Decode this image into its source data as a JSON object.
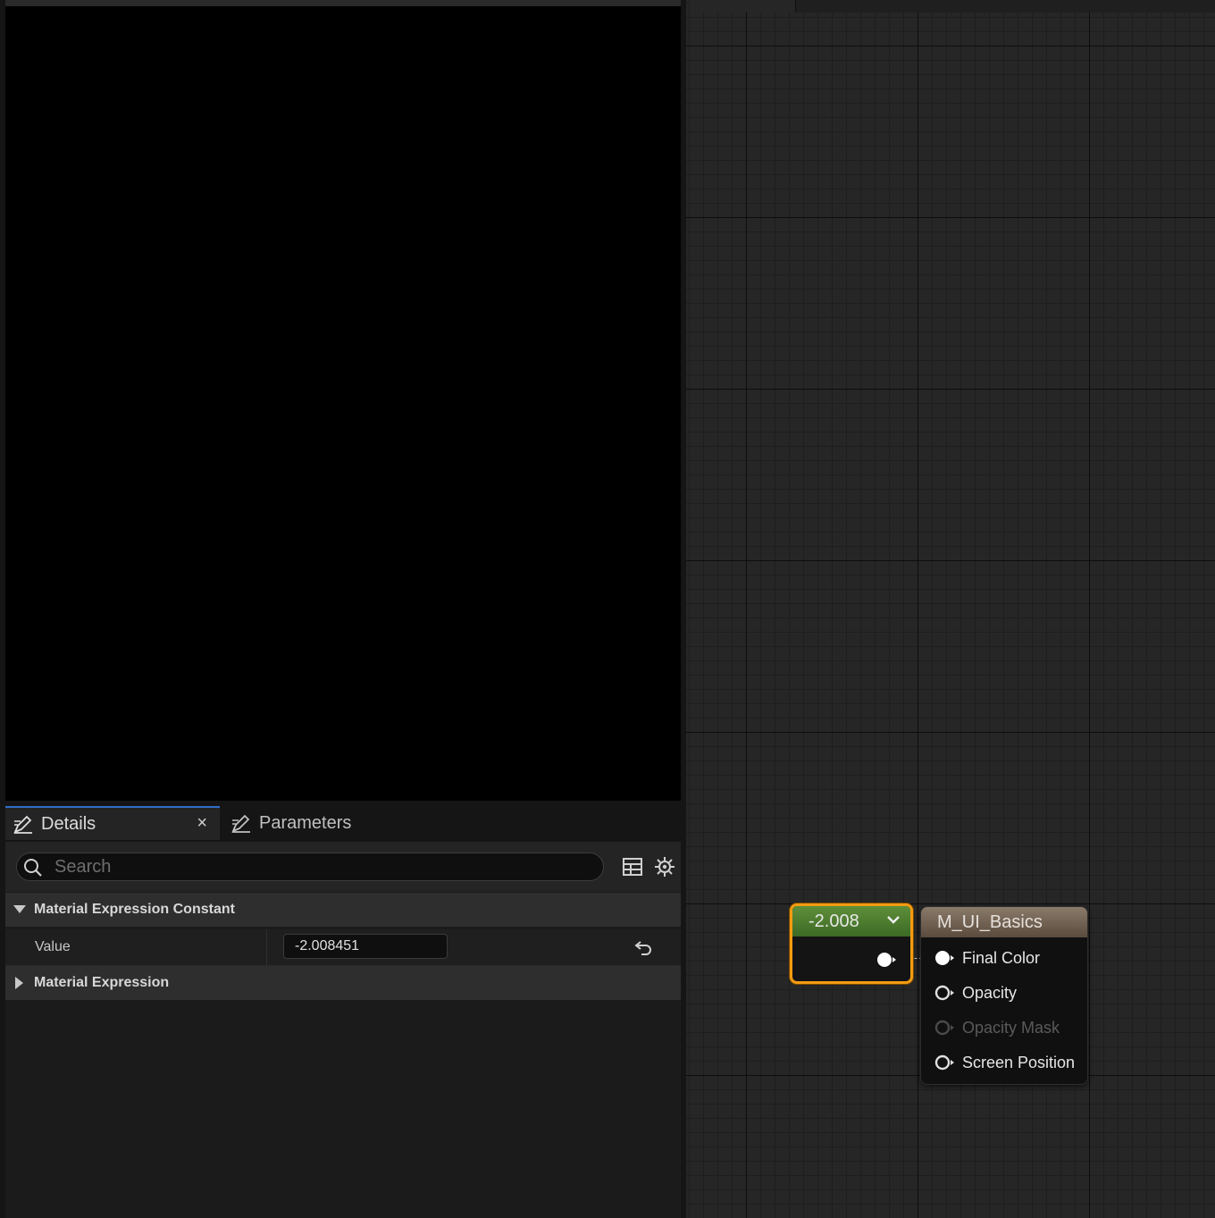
{
  "details_panel": {
    "tabs": [
      {
        "label": "Details",
        "active": true,
        "icon": "details-pencil-icon"
      },
      {
        "label": "Parameters",
        "active": false,
        "icon": "parameters-pencil-icon"
      }
    ],
    "close_glyph": "×",
    "search": {
      "placeholder": "Search",
      "value": ""
    },
    "categories": [
      {
        "label": "Material Expression Constant",
        "expanded": true,
        "properties": [
          {
            "name": "Value",
            "value": "-2.008451"
          }
        ]
      },
      {
        "label": "Material Expression",
        "expanded": false
      }
    ]
  },
  "graph": {
    "constant_node": {
      "title": "-2.008",
      "selected": true,
      "header_color": "#4a7a2e",
      "selection_color": "#f39c12"
    },
    "material_node": {
      "title": "M_UI_Basics",
      "header_color": "#7a6b5c",
      "inputs": [
        {
          "label": "Final Color",
          "connected": true,
          "enabled": true
        },
        {
          "label": "Opacity",
          "connected": false,
          "enabled": true
        },
        {
          "label": "Opacity Mask",
          "connected": false,
          "enabled": false
        },
        {
          "label": "Screen Position",
          "connected": false,
          "enabled": true
        }
      ]
    }
  }
}
